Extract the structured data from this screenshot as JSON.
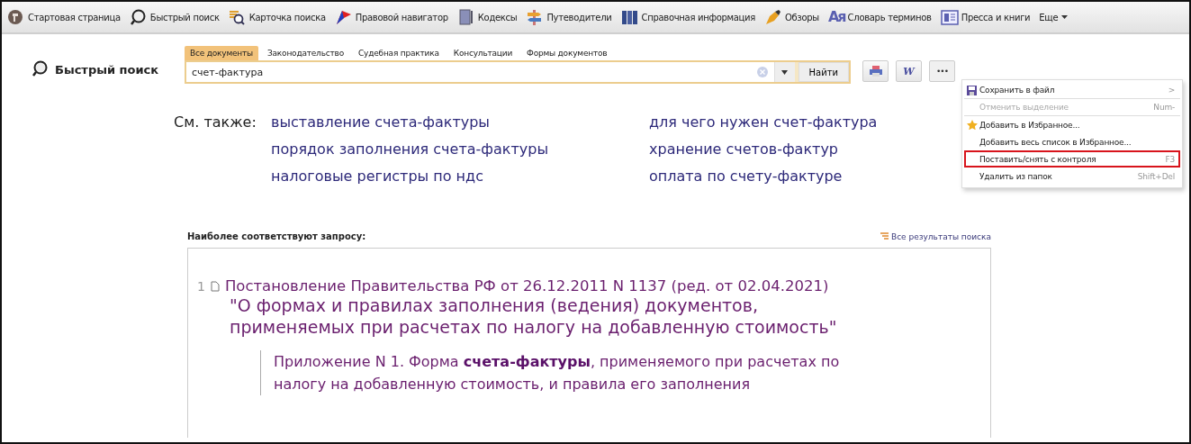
{
  "toolbar": {
    "items": [
      {
        "label": "Стартовая страница",
        "kind": "home"
      },
      {
        "label": "Быстрый поиск",
        "kind": "search"
      },
      {
        "label": "Карточка поиска",
        "kind": "card"
      },
      {
        "label": "Правовой навигатор",
        "kind": "flag"
      },
      {
        "label": "Кодексы",
        "kind": "book"
      },
      {
        "label": "Путеводители",
        "kind": "signpost"
      },
      {
        "label": "Справочная информация",
        "kind": "binders"
      },
      {
        "label": "Обзоры",
        "kind": "pen"
      },
      {
        "label": "Словарь терминов",
        "kind": "letters",
        "icon_text": "Ая"
      },
      {
        "label": "Пресса и книги",
        "kind": "press"
      },
      {
        "label": "Еще",
        "kind": "dropdown"
      }
    ]
  },
  "page_title": "Быстрый поиск",
  "search": {
    "tabs": [
      {
        "label": "Все документы",
        "selected": true
      },
      {
        "label": "Законодательство",
        "selected": false
      },
      {
        "label": "Судебная практика",
        "selected": false
      },
      {
        "label": "Консультации",
        "selected": false
      },
      {
        "label": "Формы документов",
        "selected": false
      }
    ],
    "value": "счет-фактура",
    "button": "Найти"
  },
  "actions": [
    {
      "kind": "print"
    },
    {
      "kind": "word",
      "text": "W"
    },
    {
      "kind": "more",
      "text": "•••"
    }
  ],
  "menu": {
    "items": [
      {
        "label": "Сохранить в файл",
        "shortcut": ">",
        "kind": "save",
        "disabled": false,
        "highlighted": false,
        "divider_after": true
      },
      {
        "label": "Отменить выделение",
        "kind": "plain",
        "shortcut": "Num-",
        "disabled": true,
        "highlighted": false,
        "divider_after": true
      },
      {
        "label": "Добавить в Избранное...",
        "kind": "favorite",
        "disabled": false,
        "highlighted": false,
        "divider_after": false
      },
      {
        "label": "Добавить весь список в Избранное...",
        "kind": "plain",
        "disabled": false,
        "highlighted": false,
        "divider_after": false
      },
      {
        "label": "Поставить/снять с контроля",
        "kind": "plain",
        "shortcut": "F3",
        "disabled": false,
        "highlighted": true,
        "divider_after": false
      },
      {
        "label": "Удалить из папок",
        "kind": "plain",
        "shortcut": "Shift+Del",
        "disabled": false,
        "highlighted": false,
        "divider_after": false
      }
    ]
  },
  "see_also": {
    "label": "См. также:",
    "links": [
      "выставление счета-фактуры",
      "для чего нужен счет-фактура",
      "порядок заполнения счета-фактуры",
      "хранение счетов-фактур",
      "налоговые регистры по ндс",
      "оплата по счету-фактуре"
    ]
  },
  "results": {
    "heading": "Наиболее соответствуют запросу:",
    "all_link": "Все результаты поиска",
    "items": [
      {
        "number": "1",
        "title": "Постановление Правительства РФ от 26.12.2011 N 1137 (ред. от 02.04.2021)",
        "subtitle": "\"О формах и правилах заполнения (ведения) документов,\nприменяемых при расчетах по налогу на добавленную стоимость\"",
        "snippet": "Приложение N 1. Форма **счета-фактуры**, применяемого при расчетах по\nналогу на добавленную стоимость, и правила его заполнения"
      }
    ]
  }
}
